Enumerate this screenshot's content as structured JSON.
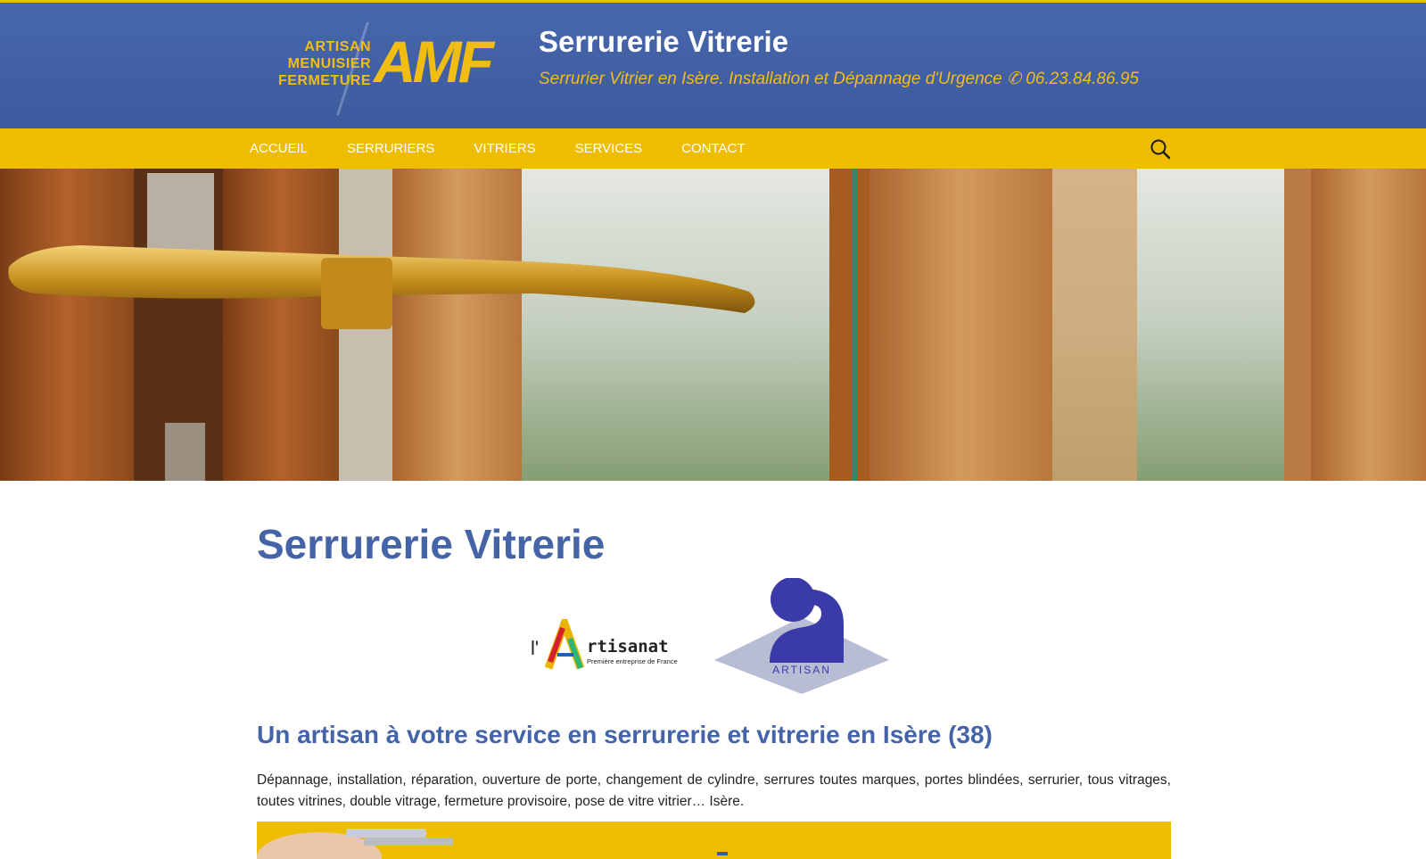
{
  "colors": {
    "header_blue": "#4563a7",
    "accent_yellow": "#efbd00",
    "text_dark": "#222222"
  },
  "logo": {
    "word1": "ARTISAN",
    "word2": "MENUISIER",
    "word3": "FERMETURE",
    "mark": "AMF"
  },
  "header": {
    "title": "Serrurerie Vitrerie",
    "description": "Serrurier Vitrier en Isère. Installation et Dépannage d'Urgence ✆ 06.23.84.86.95"
  },
  "nav": {
    "items": [
      {
        "label": "ACCUEIL"
      },
      {
        "label": "SERRURIERS"
      },
      {
        "label": "VITRIERS"
      },
      {
        "label": "SERVICES"
      },
      {
        "label": "CONTACT"
      }
    ],
    "search_icon": "search-icon"
  },
  "main": {
    "title": "Serrurerie Vitrerie",
    "badge1": {
      "prefix": "l'",
      "name": "rtisanat",
      "tagline": "Première entreprise de France"
    },
    "badge2": {
      "label": "ARTISAN"
    },
    "subtitle": "Un artisan à votre service en serrurerie et vitrerie en Isère (38)",
    "paragraph": "Dépannage, installation, réparation, ouverture de porte, changement de cylindre, serrures toutes marques, portes blindées, serrurier, tous vitrages, toutes vitrines, double vitrage, fermeture provisoire, pose de vitre vitrier… Isère."
  }
}
